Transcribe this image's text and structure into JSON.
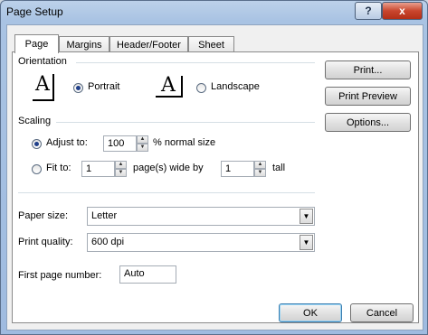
{
  "window": {
    "title": "Page Setup",
    "help_icon": "?",
    "close_icon": "x"
  },
  "tabs": [
    {
      "label": "Page",
      "active": true
    },
    {
      "label": "Margins",
      "active": false
    },
    {
      "label": "Header/Footer",
      "active": false
    },
    {
      "label": "Sheet",
      "active": false
    }
  ],
  "orientation": {
    "heading": "Orientation",
    "portrait_label": "Portrait",
    "landscape_label": "Landscape",
    "selected": "portrait",
    "glyph": "A"
  },
  "scaling": {
    "heading": "Scaling",
    "adjust_to_label": "Adjust to:",
    "adjust_value": "100",
    "adjust_suffix": "% normal size",
    "fit_to_label": "Fit to:",
    "fit_wide_value": "1",
    "fit_wide_suffix": "page(s) wide by",
    "fit_tall_value": "1",
    "fit_tall_suffix": "tall",
    "selected": "adjust"
  },
  "paper": {
    "paper_size_label": "Paper size:",
    "paper_size_value": "Letter",
    "print_quality_label": "Print quality:",
    "print_quality_value": "600 dpi",
    "first_page_label": "First page number:",
    "first_page_value": "Auto"
  },
  "side_buttons": {
    "print": "Print...",
    "print_preview": "Print Preview",
    "options": "Options..."
  },
  "footer": {
    "ok": "OK",
    "cancel": "Cancel"
  }
}
